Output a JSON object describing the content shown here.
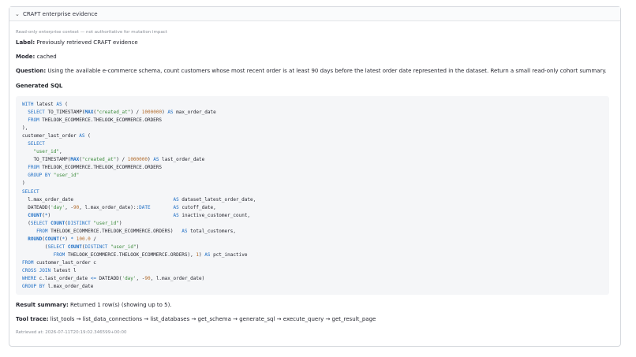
{
  "expander": {
    "title": "CRAFT enterprise evidence",
    "chevron": "chevron-down-icon"
  },
  "caption": "Read-only enterprise context — not authoritative for mutation impact",
  "fields": {
    "label_key": "Label:",
    "label_value": "Previously retrieved CRAFT evidence",
    "mode_key": "Mode:",
    "mode_value": "cached",
    "question_key": "Question:",
    "question_value": "Using the available e-commerce schema, count customers whose most recent order is at least 90 days before the latest order date represented in the dataset. Return a small read-only cohort summary."
  },
  "sql_title": "Generated SQL",
  "sql_lines": [
    "WITH latest AS (",
    "  SELECT TO_TIMESTAMP(MAX(\"created_at\") / 1000000) AS max_order_date",
    "  FROM THELOOK_ECOMMERCE.THELOOK_ECOMMERCE.ORDERS",
    "),",
    "customer_last_order AS (",
    "  SELECT",
    "    \"user_id\",",
    "    TO_TIMESTAMP(MAX(\"created_at\") / 1000000) AS last_order_date",
    "  FROM THELOOK_ECOMMERCE.THELOOK_ECOMMERCE.ORDERS",
    "  GROUP BY \"user_id\"",
    ")",
    "SELECT",
    "  l.max_order_date                                   AS dataset_latest_order_date,",
    "  DATEADD('day', -90, l.max_order_date)::DATE        AS cutoff_date,",
    "  COUNT(*)                                           AS inactive_customer_count,",
    "  (SELECT COUNT(DISTINCT \"user_id\")",
    "     FROM THELOOK_ECOMMERCE.THELOOK_ECOMMERCE.ORDERS)   AS total_customers,",
    "  ROUND(COUNT(*) * 100.0 /",
    "        (SELECT COUNT(DISTINCT \"user_id\")",
    "           FROM THELOOK_ECOMMERCE.THELOOK_ECOMMERCE.ORDERS), 1) AS pct_inactive",
    "FROM customer_last_order c",
    "CROSS JOIN latest l",
    "WHERE c.last_order_date <= DATEADD('day', -90, l.max_order_date)",
    "GROUP BY l.max_order_date"
  ],
  "result": {
    "key": "Result summary:",
    "value": "Returned 1 row(s) (showing up to 5)."
  },
  "trace": {
    "key": "Tool trace:",
    "value": "list_tools → list_data_connections → list_databases → get_schema → generate_sql → execute_query → get_result_page"
  },
  "retrieved": "Retrieved at: 2026-07-11T20:19:02.346599+00:00"
}
